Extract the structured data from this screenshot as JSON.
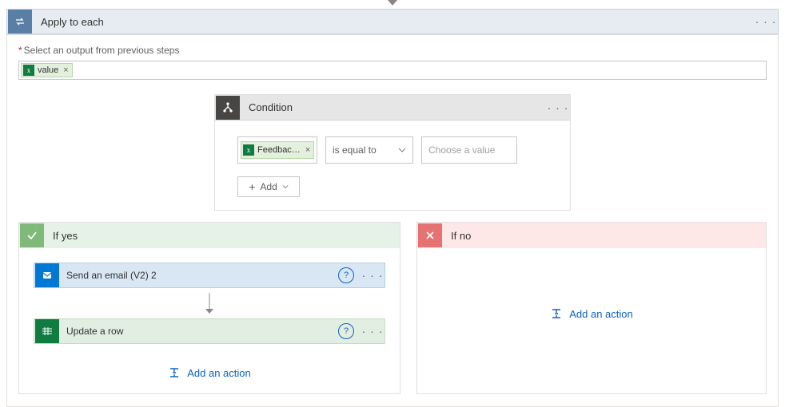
{
  "top": {
    "title": "Apply to each",
    "select_label": "Select an output from previous steps",
    "prev_token": "value"
  },
  "condition": {
    "title": "Condition",
    "lhs_token": "Feedbac…",
    "operator": "is equal to",
    "rhs_placeholder": "Choose a value",
    "add_label": "Add"
  },
  "branches": {
    "yes": {
      "title": "If yes",
      "actions": [
        {
          "kind": "outlook",
          "title": "Send an email (V2) 2"
        },
        {
          "kind": "excel",
          "title": "Update a row"
        }
      ],
      "add_action": "Add an action"
    },
    "no": {
      "title": "If no",
      "add_action": "Add an action"
    }
  }
}
